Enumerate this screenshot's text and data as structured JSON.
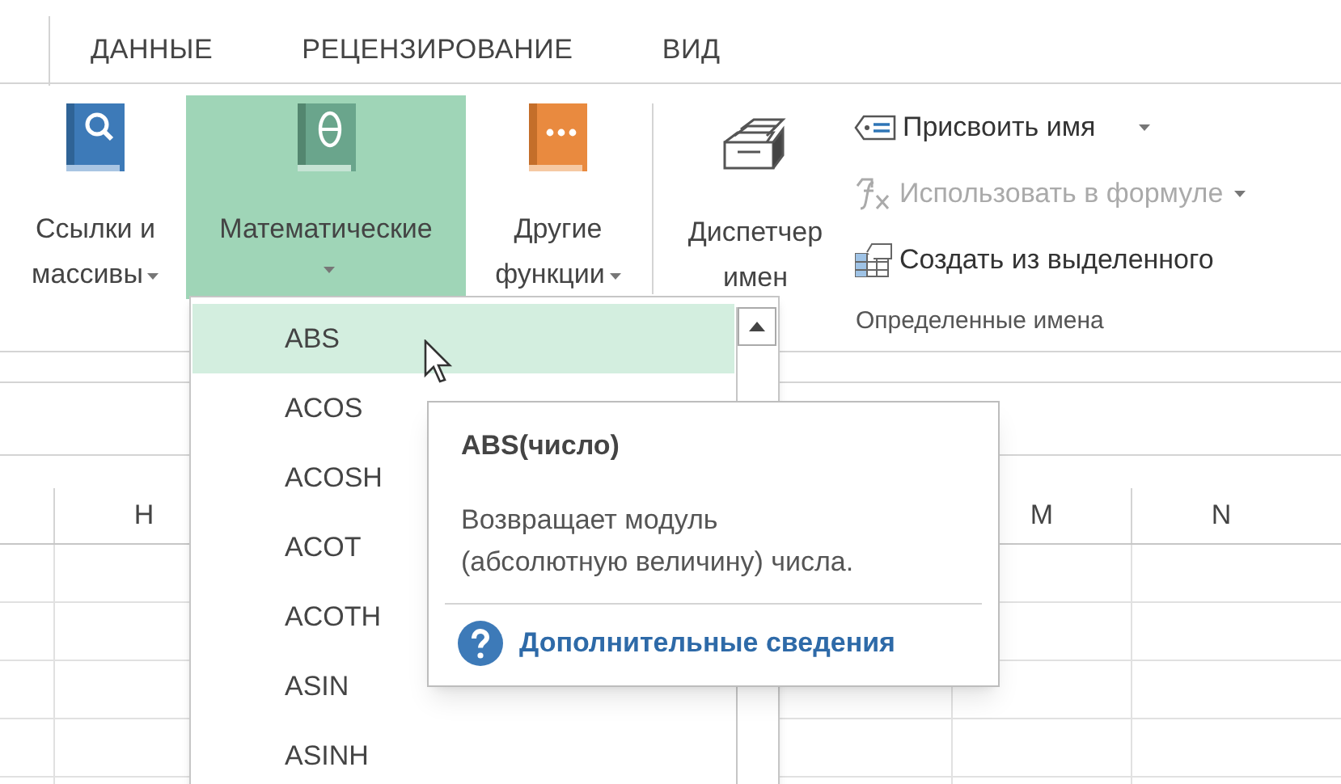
{
  "tabs": [
    {
      "label": "ДАННЫЕ",
      "selected": false
    },
    {
      "label": "РЕЦЕНЗИРОВАНИЕ",
      "selected": false
    },
    {
      "label": "ВИД",
      "selected": false
    }
  ],
  "ribbon": {
    "function_buttons": [
      {
        "kind": "links",
        "lines": [
          "Ссылки и",
          "массивы"
        ],
        "selected": false
      },
      {
        "kind": "math",
        "lines": [
          "Математические"
        ],
        "selected": true
      },
      {
        "kind": "other",
        "lines": [
          "Другие",
          "функции"
        ],
        "selected": false
      }
    ],
    "name_manager": {
      "lines": [
        "Диспетчер",
        "имен"
      ]
    },
    "name_commands": [
      {
        "kind": "tag",
        "label": "Присвоить имя",
        "disabled": false
      },
      {
        "kind": "fx",
        "label": "Использовать в формуле",
        "disabled": true
      },
      {
        "kind": "table",
        "label": "Создать из выделенного",
        "disabled": false
      }
    ],
    "group_label": "Определенные имена"
  },
  "column_headers": [
    "H",
    "M",
    "N"
  ],
  "function_menu": {
    "items": [
      {
        "label": "ABS",
        "selected": true
      },
      {
        "label": "ACOS",
        "selected": false
      },
      {
        "label": "ACOSH",
        "selected": false
      },
      {
        "label": "ACOT",
        "selected": false
      },
      {
        "label": "ACOTH",
        "selected": false
      },
      {
        "label": "ASIN",
        "selected": false
      },
      {
        "label": "ASINH",
        "selected": false
      }
    ]
  },
  "tooltip": {
    "title": "ABS(число)",
    "description": [
      "Возвращает модуль",
      "(абсолютную величину) числа."
    ],
    "link": "Дополнительные сведения"
  }
}
